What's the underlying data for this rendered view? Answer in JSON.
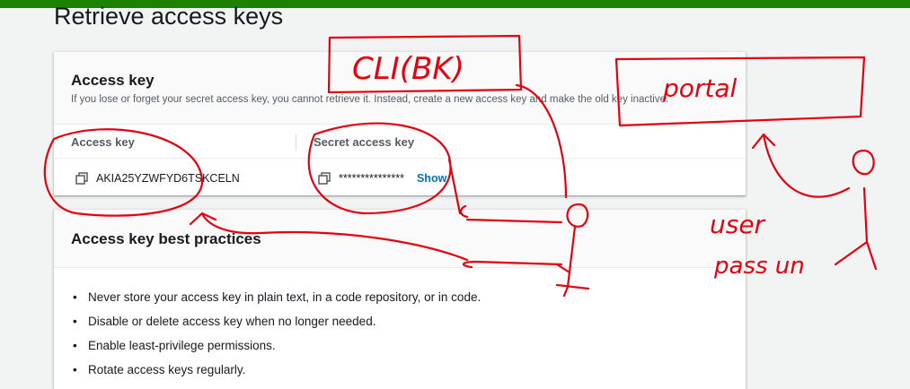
{
  "page": {
    "title": "Retrieve access keys"
  },
  "access_key_card": {
    "title": "Access key",
    "description": "If you lose or forget your secret access key, you cannot retrieve it. Instead, create a new access key and make the old key inactive.",
    "columns": [
      "Access key",
      "Secret access key"
    ],
    "access_key_value": "AKIA25YZWFYD6TSKCELN",
    "secret_value": "***************",
    "show_label": "Show"
  },
  "best_practices_card": {
    "title": "Access key best practices",
    "items": [
      "Never store your access key in plain text, in a code repository, or in code.",
      "Disable or delete access key when no longer needed.",
      "Enable least-privilege permissions.",
      "Rotate access keys regularly."
    ]
  },
  "annotations": {
    "cli_label": "CLI(BK)",
    "portal_label": "portal",
    "user_label": "user",
    "pass_label": "pass un"
  },
  "colors": {
    "topbar": "#1d8102",
    "link": "#0073bb",
    "annotation": "#e4000f"
  }
}
